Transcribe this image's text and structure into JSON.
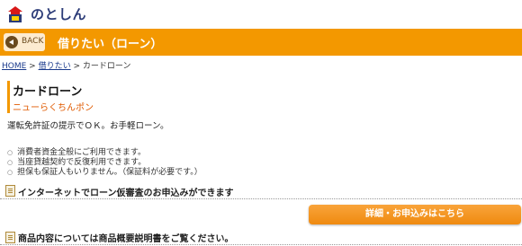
{
  "brand": {
    "logo_text": "のとしん",
    "logo_icon": "notoshin-logo-mark"
  },
  "header": {
    "back_label": "BACK",
    "title": "借りたい（ローン）",
    "accent": "#f39800"
  },
  "breadcrumb": {
    "home": "HOME",
    "sep1": " > ",
    "parent": "借りたい",
    "sep2": " > ",
    "current": "カードローン"
  },
  "product": {
    "title": "カードローン",
    "subtitle": "ニューらくちんポン",
    "description": "運転免許証の提示でＯＫ。お手軽ローン。"
  },
  "features": [
    "消費者資金全般にご利用できます。",
    "当座貸越契約で反復利用できます。",
    "担保も保証人もいりません。（保証料が必要です。）"
  ],
  "notes": {
    "internet": "インターネットでローン仮審査のお申込みができます",
    "overview": "商品内容については商品概要説明書をご覧ください。"
  },
  "apply_button": "詳細・お申込みはこちら"
}
